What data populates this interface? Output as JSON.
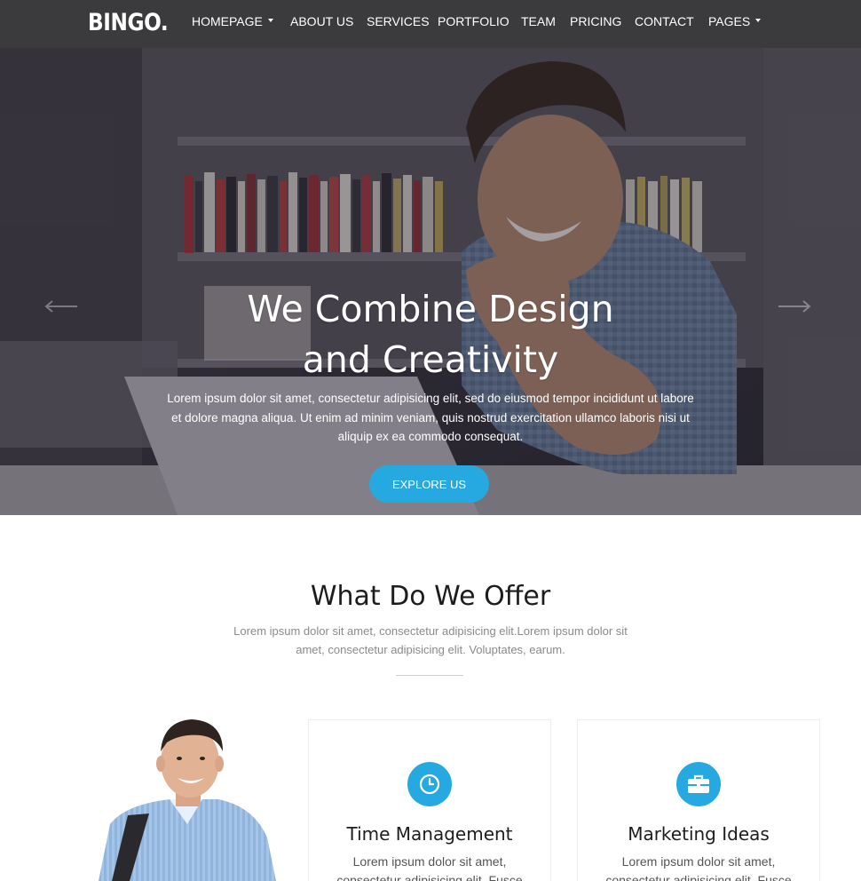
{
  "brand": {
    "logo": "BINGO."
  },
  "nav": {
    "items": [
      {
        "label": "HOMEPAGE",
        "dropdown": true
      },
      {
        "label": "ABOUT US"
      },
      {
        "label": "SERVICES"
      },
      {
        "label": "PORTFOLIO"
      },
      {
        "label": "TEAM"
      },
      {
        "label": "PRICING"
      },
      {
        "label": "CONTACT"
      },
      {
        "label": "PAGES",
        "dropdown": true
      }
    ]
  },
  "hero": {
    "title_line1": "We Combine Design",
    "title_line2": "and Creativity",
    "text": "Lorem ipsum dolor sit amet, consectetur adipisicing elit, sed do eiusmod tempor incididunt ut labore et dolore magna aliqua. Ut enim ad minim veniam, quis nostrud exercitation ullamco laboris nisi ut aliquip ex ea commodo consequat.",
    "button_label": "EXPLORE US"
  },
  "offer": {
    "title": "What Do We Offer",
    "subtitle": "Lorem ipsum dolor sit amet, consectetur adipisicing elit.Lorem ipsum dolor sit amet, consectetur adipisicing elit. Voluptates, earum.",
    "cards": [
      {
        "icon": "clock-icon",
        "title": "Time Management",
        "text": "Lorem ipsum dolor sit amet, consectetur adipisicing elit. Fusce"
      },
      {
        "icon": "briefcase-icon",
        "title": "Marketing Ideas",
        "text": "Lorem ipsum dolor sit amet, consectetur adipisicing elit. Fusce"
      }
    ]
  },
  "colors": {
    "accent": "#26a9e1",
    "navbar": "#3b3b3d",
    "heading": "#1d1d1d",
    "muted_text": "#8a8a8a"
  }
}
